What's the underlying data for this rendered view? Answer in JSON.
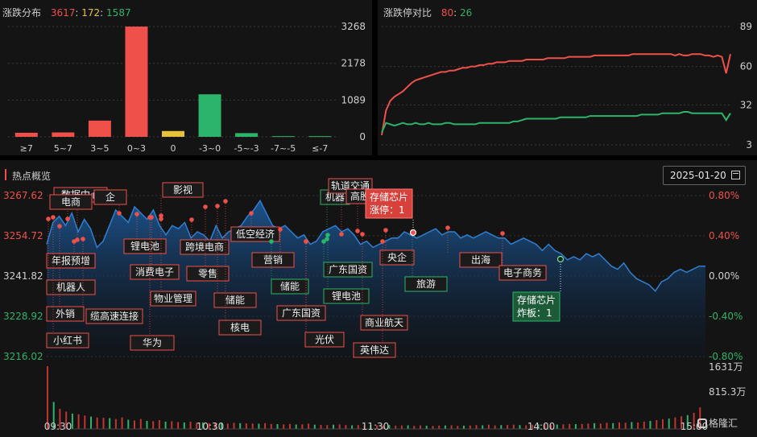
{
  "dist_panel": {
    "title": "涨跌分布",
    "up_count": "3617",
    "sep": ":",
    "flat_count": "172",
    "down_count": "1587"
  },
  "ratio_panel": {
    "title": "涨跌停对比",
    "limit_up": "80",
    "sep": ":",
    "limit_down": "26"
  },
  "hot_panel": {
    "title": "热点概览",
    "date": "2025-01-20",
    "calendar_icon": "calendar-icon"
  },
  "logo": {
    "text": "格隆汇",
    "icon": "glh-logo-icon"
  },
  "colors": {
    "up": "#f0504a",
    "down": "#2bb46a",
    "flat": "#e8c13a",
    "line": "#1a6ab8"
  },
  "chart_data": [
    {
      "type": "bar",
      "categories": [
        "≥7",
        "5~7",
        "3~5",
        "0~3",
        "0",
        "-3~0",
        "-5~-3",
        "-7~-5",
        "≤-7"
      ],
      "values": [
        120,
        130,
        480,
        3268,
        172,
        1260,
        110,
        20,
        20
      ],
      "bar_colors": [
        "up",
        "up",
        "up",
        "up",
        "flat",
        "down",
        "down",
        "down",
        "down"
      ],
      "ylim": [
        0,
        3268
      ],
      "yticks": [
        "3268",
        "2178",
        "1089",
        "0"
      ],
      "grid": true
    },
    {
      "type": "line",
      "yticks": [
        "89",
        "60",
        "32",
        "3"
      ],
      "ylim": [
        3,
        89
      ],
      "series": [
        {
          "color": "up",
          "values": [
            10,
            28,
            35,
            38,
            40,
            42,
            45,
            48,
            50,
            51,
            52,
            53,
            54,
            55,
            56,
            56,
            57,
            57,
            58,
            59,
            59,
            60,
            60,
            61,
            61,
            62,
            62,
            63,
            63,
            63,
            64,
            64,
            64,
            64,
            65,
            65,
            65,
            65,
            65,
            66,
            66,
            66,
            66,
            66,
            67,
            67,
            67,
            67,
            67,
            67,
            68,
            68,
            68,
            68,
            68,
            68,
            68,
            68,
            68,
            69,
            69,
            69,
            69,
            69,
            69,
            69,
            69,
            69,
            69,
            68,
            69,
            68,
            68,
            69,
            69,
            69,
            68,
            68,
            67,
            68,
            67,
            55,
            69
          ]
        },
        {
          "color": "down",
          "values": [
            12,
            19,
            18,
            17,
            18,
            19,
            18,
            18,
            19,
            18,
            18,
            19,
            18,
            18,
            18,
            19,
            19,
            18,
            18,
            18,
            18,
            18,
            18,
            19,
            19,
            19,
            19,
            19,
            19,
            19,
            19,
            20,
            20,
            21,
            22,
            22,
            22,
            22,
            22,
            22,
            22,
            22,
            23,
            23,
            23,
            23,
            23,
            23,
            23,
            24,
            24,
            24,
            24,
            24,
            24,
            24,
            24,
            24,
            24,
            24,
            24,
            25,
            25,
            25,
            25,
            25,
            26,
            26,
            26,
            26,
            26,
            27,
            27,
            26,
            26,
            26,
            26,
            26,
            26,
            26,
            26,
            21,
            26
          ]
        }
      ]
    },
    {
      "type": "area",
      "x_ticks": [
        "09:30",
        "10:30",
        "11:30",
        "14:00",
        "15:00"
      ],
      "y_ticks_left": [
        "3267.62",
        "3254.72",
        "3241.82",
        "3228.92",
        "3216.02"
      ],
      "y_ticks_right": [
        "0.80%",
        "0.40%",
        "0.00%",
        "-0.40%",
        "-0.80%"
      ],
      "ylim": [
        3216.02,
        3267.62
      ],
      "prev_close": 3241.82,
      "index_values": [
        3252,
        3259,
        3261,
        3258,
        3262,
        3256,
        3260,
        3257,
        3251,
        3253,
        3258,
        3263,
        3261,
        3259,
        3264,
        3262,
        3260,
        3263,
        3258,
        3255,
        3258,
        3257,
        3259,
        3254,
        3256,
        3255,
        3253,
        3258,
        3254,
        3256,
        3257,
        3258,
        3261,
        3263,
        3266,
        3262,
        3258,
        3257,
        3258,
        3256,
        3254,
        3255,
        3252,
        3253,
        3256,
        3257,
        3258,
        3256,
        3257,
        3255,
        3252,
        3253,
        3251,
        3252,
        3253,
        3254,
        3254,
        3256,
        3255,
        3254,
        3255,
        3256,
        3257,
        3255,
        3256,
        3256,
        3254,
        3255,
        3254,
        3255,
        3256,
        3255,
        3254,
        3254,
        3252,
        3253,
        3254,
        3253,
        3252,
        3250,
        3252,
        3250,
        3249,
        3247,
        3248,
        3247,
        3249,
        3248,
        3249,
        3247,
        3245,
        3244,
        3246,
        3243,
        3241,
        3240,
        3239,
        3237,
        3240,
        3241,
        3243,
        3244,
        3243,
        3244,
        3245,
        3245
      ],
      "volume_ticks": [
        "1631万",
        "815.3万"
      ],
      "volume_values": [
        1631,
        700,
        520,
        450,
        400,
        380,
        350,
        320,
        300,
        290,
        280,
        260,
        300,
        240,
        220,
        260,
        210,
        200,
        230,
        190,
        200,
        180,
        170,
        190,
        160,
        170,
        150,
        160,
        150,
        140,
        160,
        150,
        145,
        140,
        135,
        150,
        130,
        125,
        120,
        130,
        115,
        120,
        140,
        110,
        105,
        100,
        110,
        120,
        100,
        95,
        100,
        90,
        105,
        95,
        90,
        100,
        85,
        90,
        95,
        80,
        90,
        85,
        80,
        85,
        90,
        95,
        80,
        85,
        90,
        100,
        95,
        110,
        90,
        100,
        105,
        110,
        100,
        95,
        110,
        120,
        130,
        110,
        115,
        120,
        130,
        125,
        130,
        140,
        150,
        140,
        160,
        150,
        170,
        160,
        180,
        170,
        190,
        210,
        230,
        250,
        270,
        300,
        330,
        360,
        420,
        560
      ],
      "labels": [
        {
          "text": "数据中心",
          "color": "up"
        },
        {
          "text": "电商",
          "color": "up"
        },
        {
          "text": "企",
          "color": "up"
        },
        {
          "text": "影视",
          "color": "up"
        },
        {
          "text": "年报预增",
          "color": "up"
        },
        {
          "text": "锂电池",
          "color": "up"
        },
        {
          "text": "跨境电商",
          "color": "up"
        },
        {
          "text": "低空经济",
          "color": "up"
        },
        {
          "text": "消费电子",
          "color": "up"
        },
        {
          "text": "零售",
          "color": "up"
        },
        {
          "text": "机器人",
          "color": "up"
        },
        {
          "text": "物业管理",
          "color": "up"
        },
        {
          "text": "储能",
          "color": "up"
        },
        {
          "text": "外销",
          "color": "up"
        },
        {
          "text": "缆高速连接",
          "color": "up"
        },
        {
          "text": "核电",
          "color": "up"
        },
        {
          "text": "小红书",
          "color": "up"
        },
        {
          "text": "华为",
          "color": "up"
        },
        {
          "text": "营销",
          "color": "up"
        },
        {
          "text": "储能",
          "color": "down"
        },
        {
          "text": "广东国资",
          "color": "up"
        },
        {
          "text": "机器",
          "color": "down"
        },
        {
          "text": "轨道交通",
          "color": "up"
        },
        {
          "text": "高股",
          "color": "up"
        },
        {
          "text": "广东国资",
          "color": "down"
        },
        {
          "text": "锂电池",
          "color": "down"
        },
        {
          "text": "光伏",
          "color": "up"
        },
        {
          "text": "央企",
          "color": "up"
        },
        {
          "text": "商业航天",
          "color": "up"
        },
        {
          "text": "英伟达",
          "color": "up"
        },
        {
          "text": "旅游",
          "color": "down"
        },
        {
          "text": "出海",
          "color": "up"
        },
        {
          "text": "电子商务",
          "color": "up"
        }
      ],
      "callouts": [
        {
          "name": "存储芯片",
          "detail": "涨停：1",
          "color": "up"
        },
        {
          "name": "存储芯片",
          "detail": "炸板：1",
          "color": "down"
        }
      ]
    }
  ]
}
